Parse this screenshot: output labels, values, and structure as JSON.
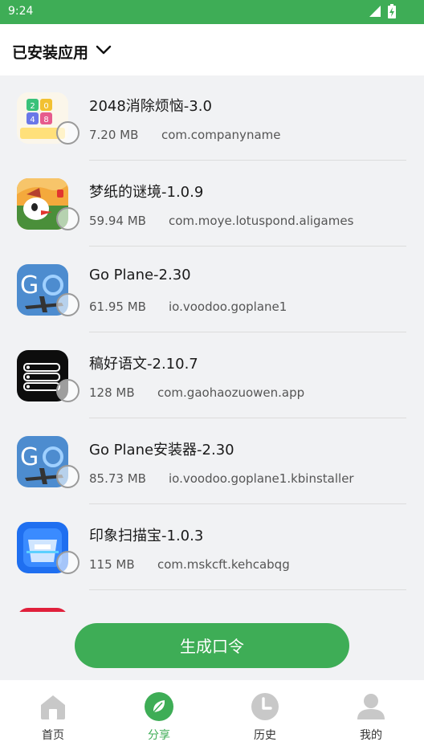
{
  "status_bar": {
    "time": "9:24"
  },
  "header": {
    "title": "已安装应用"
  },
  "apps": [
    {
      "name": "2048消除烦恼-3.0",
      "size": "7.20 MB",
      "package": "com.companyname",
      "icon": "2048-game-icon"
    },
    {
      "name": "梦纸的谜境-1.0.9",
      "size": "59.94 MB",
      "package": "com.moye.lotuspond.aligames",
      "icon": "dream-paper-icon"
    },
    {
      "name": "Go Plane-2.30",
      "size": "61.95 MB",
      "package": "io.voodoo.goplane1",
      "icon": "go-plane-icon"
    },
    {
      "name": "稿好语文-2.10.7",
      "size": "128 MB",
      "package": "com.gaohaozuowen.app",
      "icon": "gaohao-icon"
    },
    {
      "name": "Go Plane安装器-2.30",
      "size": "85.73 MB",
      "package": "io.voodoo.goplane1.kbinstaller",
      "icon": "go-plane-installer-icon"
    },
    {
      "name": "印象扫描宝-1.0.3",
      "size": "115 MB",
      "package": "com.mskcft.kehcabqg",
      "icon": "scanner-icon"
    }
  ],
  "generate_button": "生成口令",
  "tabs": [
    {
      "label": "首页",
      "icon": "home-icon",
      "active": false
    },
    {
      "label": "分享",
      "icon": "share-leaf-icon",
      "active": true
    },
    {
      "label": "历史",
      "icon": "clock-icon",
      "active": false
    },
    {
      "label": "我的",
      "icon": "user-icon",
      "active": false
    }
  ],
  "colors": {
    "accent": "#3ead56",
    "background": "#f1f2f4"
  }
}
